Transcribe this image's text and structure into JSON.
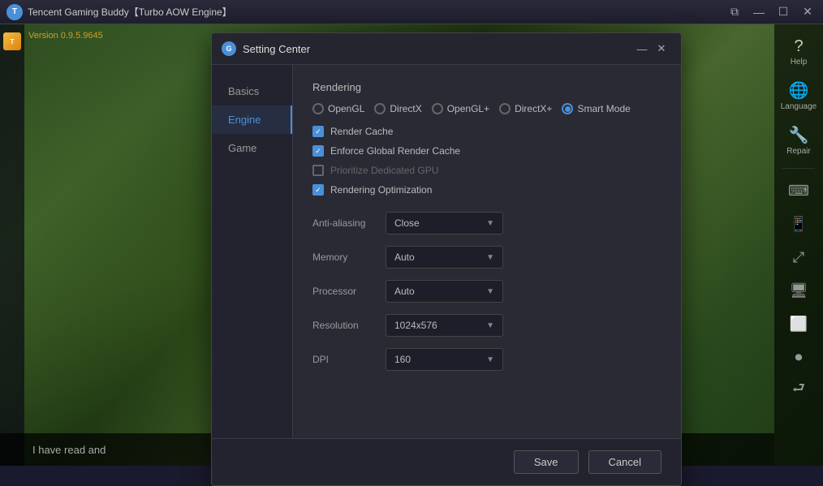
{
  "app": {
    "title": "Tencent Gaming Buddy【Turbo AOW Engine】",
    "version": "Version 0.9.5.9645"
  },
  "taskbar": {
    "controls": {
      "restore": "⧉",
      "minimize": "—",
      "maximize": "☐",
      "close": "✕"
    }
  },
  "dialog": {
    "title": "Setting Center",
    "icon_label": "G",
    "minimize": "—",
    "close": "✕",
    "nav": [
      {
        "id": "basics",
        "label": "Basics"
      },
      {
        "id": "engine",
        "label": "Engine"
      },
      {
        "id": "game",
        "label": "Game"
      }
    ],
    "active_nav": "engine",
    "content": {
      "section_title": "Rendering",
      "render_modes": [
        {
          "id": "opengl",
          "label": "OpenGL",
          "selected": false
        },
        {
          "id": "directx",
          "label": "DirectX",
          "selected": false
        },
        {
          "id": "openglplus",
          "label": "OpenGL+",
          "selected": false
        },
        {
          "id": "directxplus",
          "label": "DirectX+",
          "selected": false
        },
        {
          "id": "smartmode",
          "label": "Smart Mode",
          "selected": true
        }
      ],
      "checkboxes": [
        {
          "id": "render_cache",
          "label": "Render Cache",
          "checked": true,
          "disabled": false
        },
        {
          "id": "enforce_global",
          "label": "Enforce Global Render Cache",
          "checked": true,
          "disabled": false
        },
        {
          "id": "prioritize_gpu",
          "label": "Prioritize Dedicated GPU",
          "checked": false,
          "disabled": true
        },
        {
          "id": "rendering_opt",
          "label": "Rendering Optimization",
          "checked": true,
          "disabled": false
        }
      ],
      "selects": [
        {
          "id": "anti_aliasing",
          "label": "Anti-aliasing",
          "value": "Close"
        },
        {
          "id": "memory",
          "label": "Memory",
          "value": "Auto"
        },
        {
          "id": "processor",
          "label": "Processor",
          "value": "Auto"
        },
        {
          "id": "resolution",
          "label": "Resolution",
          "value": "1024x576"
        },
        {
          "id": "dpi",
          "label": "DPI",
          "value": "160"
        }
      ]
    },
    "footer": {
      "save_label": "Save",
      "cancel_label": "Cancel"
    }
  },
  "right_sidebar": {
    "items": [
      {
        "id": "help",
        "symbol": "?",
        "label": "Help"
      },
      {
        "id": "language",
        "symbol": "🌐",
        "label": "Language"
      },
      {
        "id": "repair",
        "symbol": "🔧",
        "label": "Repair"
      }
    ],
    "small_icons": [
      {
        "id": "keyboard",
        "symbol": "⌨"
      },
      {
        "id": "phone",
        "symbol": "📱"
      },
      {
        "id": "expand",
        "symbol": "⤢"
      },
      {
        "id": "screen",
        "symbol": "🖥"
      },
      {
        "id": "crop",
        "symbol": "⬜"
      },
      {
        "id": "record",
        "symbol": "⏺"
      },
      {
        "id": "exit",
        "symbol": "⮐"
      }
    ]
  },
  "bottom_bar": {
    "text": "I have read and"
  }
}
